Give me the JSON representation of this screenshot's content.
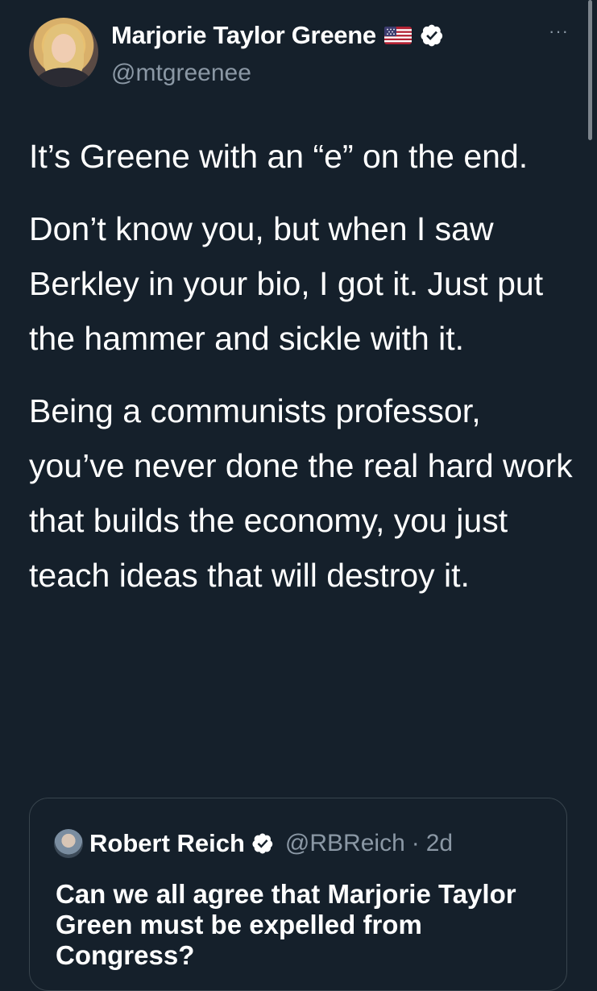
{
  "tweet": {
    "author_name": "Marjorie Taylor Greene",
    "author_handle": "@mtgreenee",
    "flag_icon": "us-flag-icon",
    "verified_icon": "verified-badge-icon",
    "more_icon": "more-options-icon",
    "more_label": "···",
    "paragraphs": [
      "It’s Greene with an “e” on the end.",
      "Don’t know you, but when I saw Berkley in your bio, I got it. Just put the hammer and sickle with it.",
      "Being a communists professor, you’ve never done the real hard work that builds the economy, you just teach ideas that will destroy it."
    ]
  },
  "quoted_tweet": {
    "author_name": "Robert Reich",
    "author_handle": "@RBReich",
    "separator": "·",
    "time": "2d",
    "text": "Can we all agree that Marjorie Taylor Green must be expelled from Congress?"
  },
  "colors": {
    "background": "#15202b",
    "text": "#ffffff",
    "secondary_text": "#8b98a5",
    "verified": "#ffffff",
    "border": "#38444d"
  }
}
